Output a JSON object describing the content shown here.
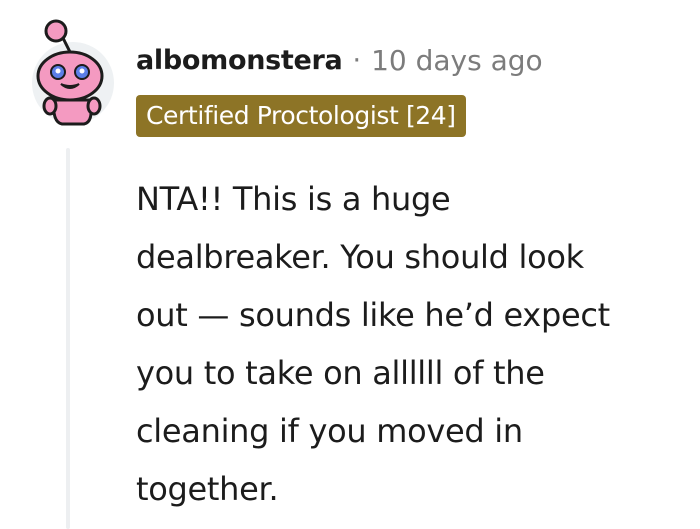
{
  "comment": {
    "username": "albomonstera",
    "separator": "·",
    "timestamp": "10 days ago",
    "flair": "Certified Proctologist [24]",
    "flair_color": "#8d7426",
    "avatar_icon": "reddit-snoo-avatar-icon",
    "body_lines": [
      "NTA!! This is a huge",
      "dealbreaker. You should look",
      "out — sounds like he’d expect",
      "you to take on allllll of the",
      "cleaning if you moved in",
      "together."
    ]
  }
}
